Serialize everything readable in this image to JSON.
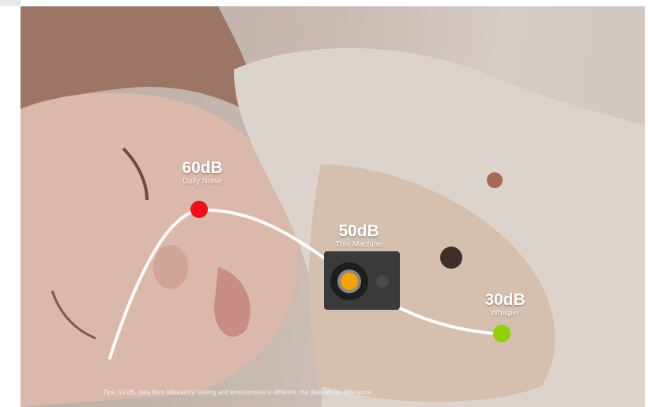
{
  "points": [
    {
      "level": "60dB",
      "caption": "Daily Noise",
      "color": "#f0101c"
    },
    {
      "level": "50dB",
      "caption": "This Machine",
      "color": "#f3a200"
    },
    {
      "level": "30dB",
      "caption": "Whisper",
      "color": "#8fd000"
    }
  ],
  "tips": "Tips: 50 dB, data from laboratory, testing and environment is different, the data will be difference."
}
